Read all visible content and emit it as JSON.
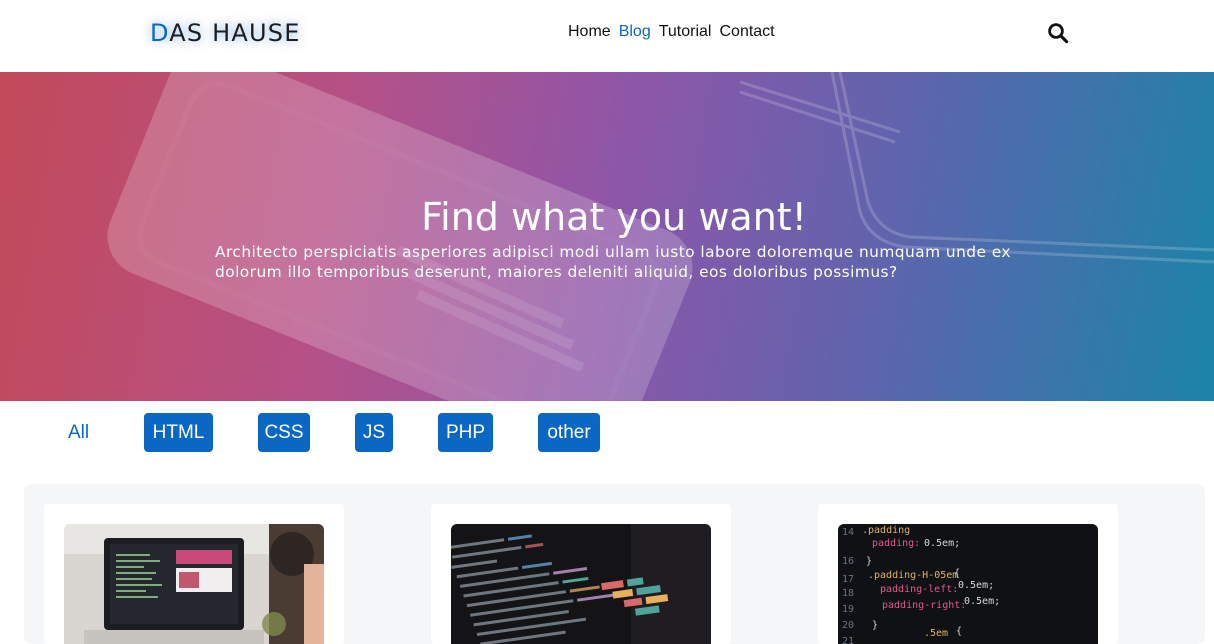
{
  "header": {
    "logo_first": "D",
    "logo_rest": "AS HAUSE",
    "nav": [
      {
        "label": "Home",
        "active": false
      },
      {
        "label": "Blog",
        "active": true
      },
      {
        "label": "Tutorial",
        "active": false
      },
      {
        "label": "Contact",
        "active": false
      }
    ],
    "search_icon": "search-icon"
  },
  "hero": {
    "title": "Find what you want!",
    "text": "Architecto perspiciatis asperiores adipisci modi ullam iusto labore doloremque numquam unde ex dolorum illo temporibus deserunt, maiores deleniti aliquid, eos doloribus possimus?"
  },
  "filters": [
    {
      "label": "All",
      "active": true
    },
    {
      "label": "HTML",
      "active": false
    },
    {
      "label": "CSS",
      "active": false
    },
    {
      "label": "JS",
      "active": false
    },
    {
      "label": "PHP",
      "active": false
    },
    {
      "label": "other",
      "active": false
    }
  ],
  "posts": [
    {
      "image": "laptop-desk-photo"
    },
    {
      "image": "code-editor-photo"
    },
    {
      "image": "css-code-photo"
    }
  ],
  "colors": {
    "accent": "#0b67c4",
    "text": "#111111",
    "hero_start": "#c24a59",
    "hero_mid": "#8e56a8",
    "hero_end": "#1b84a8",
    "posts_bg": "#f5f6f8"
  }
}
